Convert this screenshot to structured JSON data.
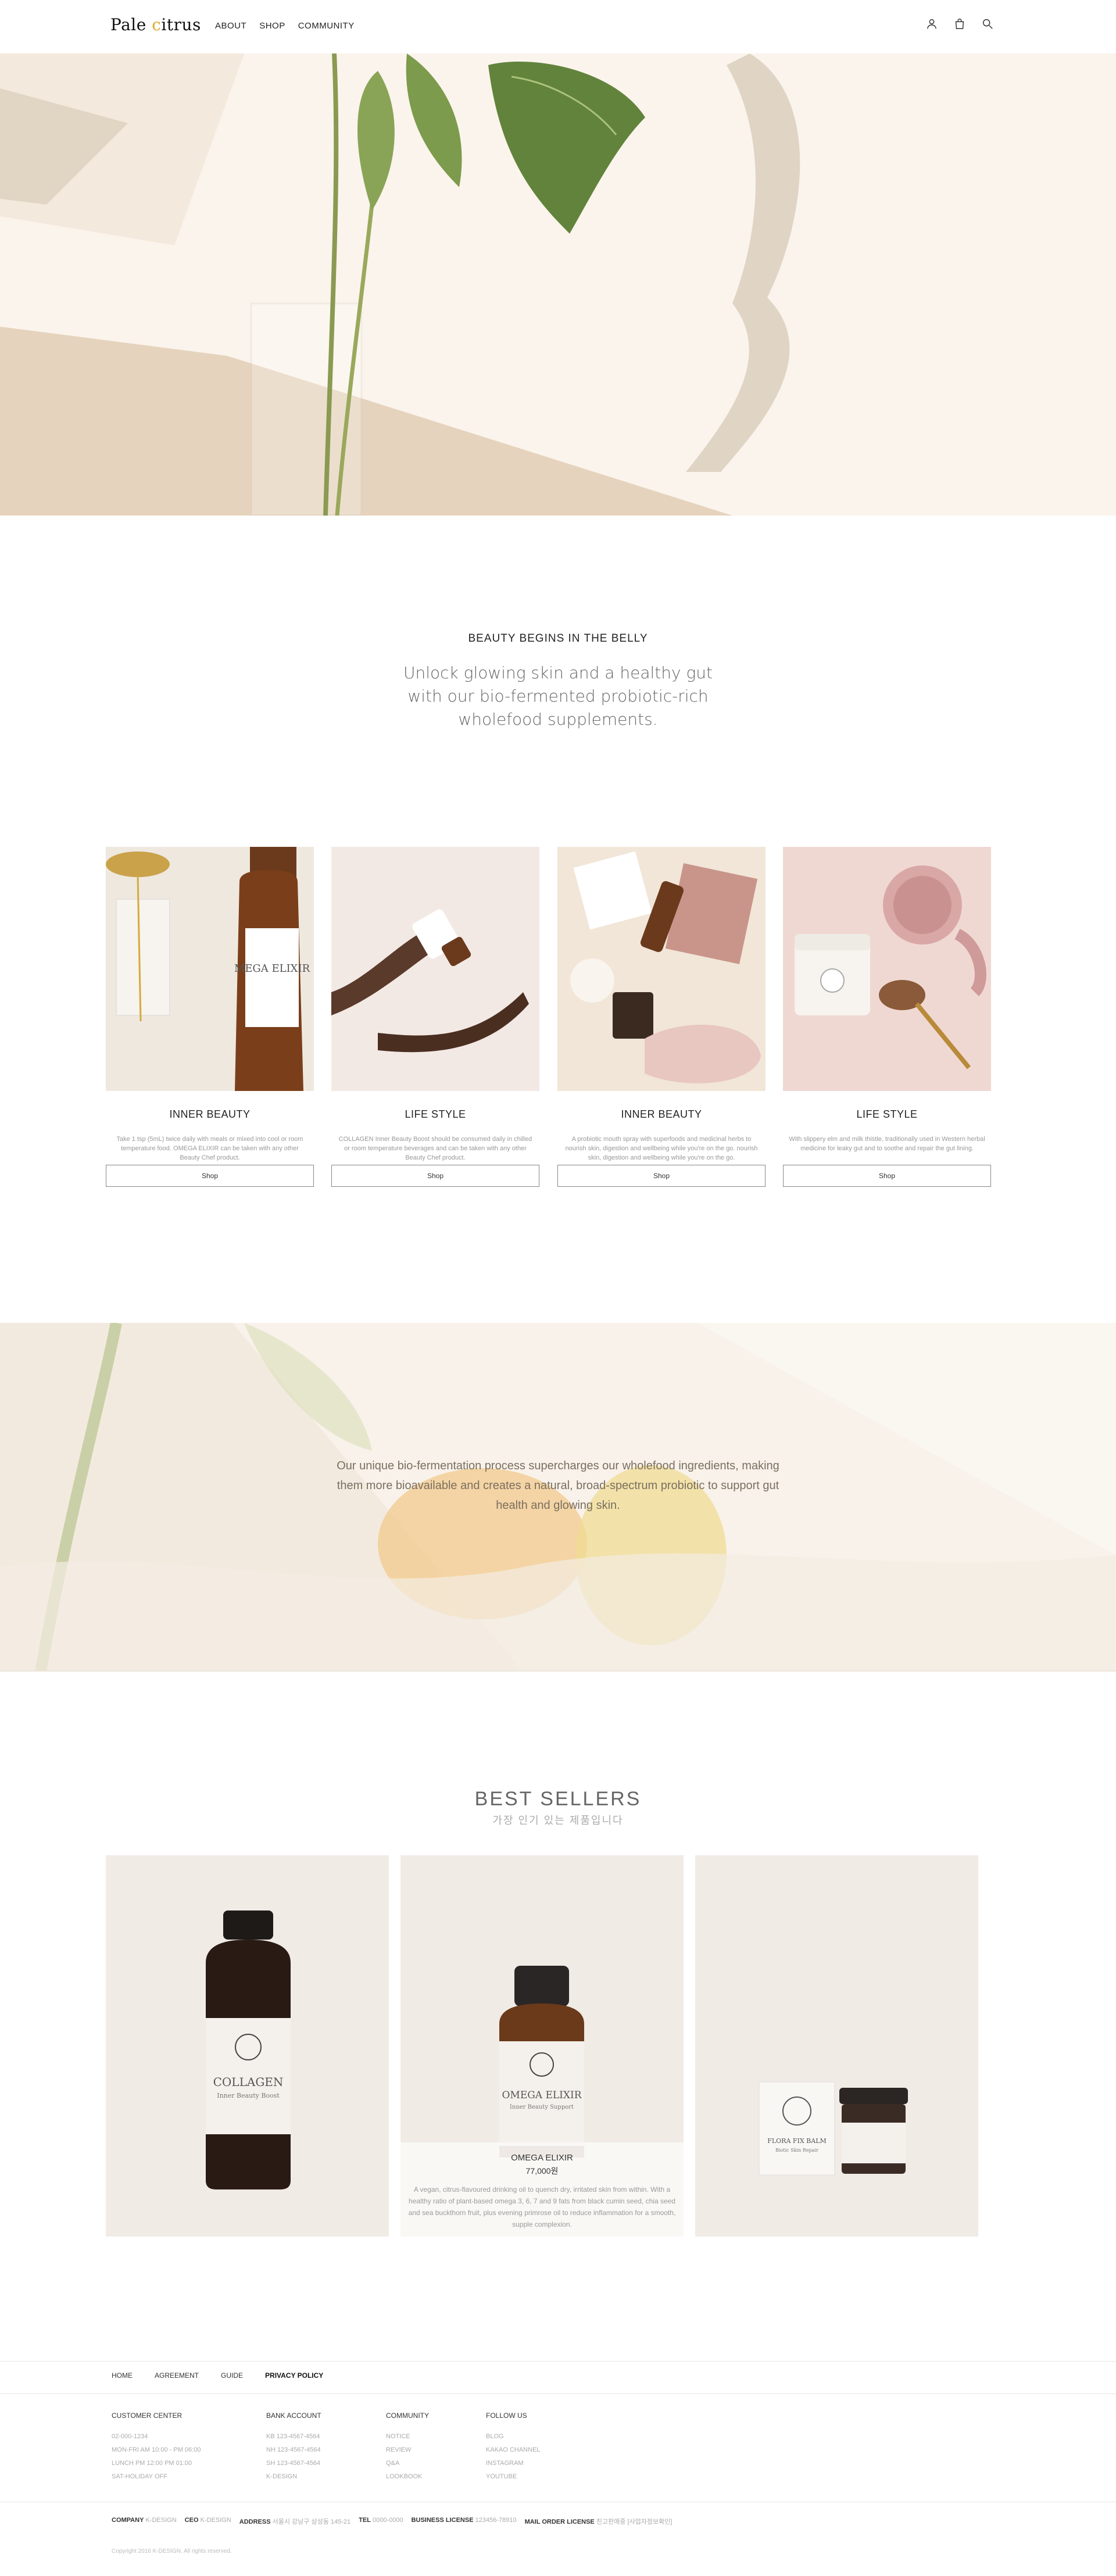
{
  "header": {
    "logo_main": "Pale ",
    "logo_accent": "c",
    "logo_rest": "itrus",
    "nav": [
      "ABOUT",
      "SHOP",
      "COMMUNITY"
    ],
    "icons": [
      "user-icon",
      "bag-icon",
      "search-icon"
    ]
  },
  "hero": {
    "slides": 3,
    "active_slide": 2
  },
  "intro": {
    "title": "BEAUTY BEGINS IN THE BELLY",
    "text": "Unlock glowing skin and a healthy gut with our bio-fermented probiotic-rich wholefood supplements."
  },
  "categories": [
    {
      "title": "INNER BEAUTY",
      "desc": "Take 1 tsp (5mL) twice daily with meals or mixed into cool or room temperature food. OMEGA ELIXIR can be taken with any other Beauty Chef product.",
      "button": "Shop"
    },
    {
      "title": "LIFE STYLE",
      "desc": "COLLAGEN Inner Beauty Boost should be consumed daily in chilled or room temperature beverages and can be taken with any other Beauty Chef product.",
      "button": "Shop"
    },
    {
      "title": "INNER BEAUTY",
      "desc": "A probiotic mouth spray with superfoods and medicinal herbs to nourish skin, digestion and wellbeing while you're on the go. nourish skin, digestion and wellbeing while you're on the go.",
      "button": "Shop"
    },
    {
      "title": "LIFE STYLE",
      "desc": "With slippery elm and milk thistle, traditionally used in Western herbal medicine for leaky gut and to soothe and repair the gut lining.",
      "button": "Shop"
    }
  ],
  "banner": {
    "text": "Our unique bio-fermentation process supercharges our wholefood ingredients, making them more bioavailable and creates a natural, broad-spectrum probiotic to support gut health and glowing skin."
  },
  "best_sellers": {
    "title": "BEST SELLERS",
    "subtitle": "가장 인기 있는 제품입니다",
    "products": [
      {
        "label": "COLLAGEN",
        "sublabel": "Inner Beauty Boost"
      },
      {
        "label": "OMEGA ELIXIR",
        "sublabel": "Inner Beauty Support",
        "name": "OMEGA ELIXIR",
        "price": "77,000원",
        "desc": "A vegan, citrus-flavoured drinking oil to quench dry, irritated skin from within. With a healthy ratio of plant-based omega 3, 6, 7 and 9 fats from black cumin seed, chia seed and sea buckthorn fruit, plus evening primrose oil to reduce inflammation for a smooth, supple complexion."
      },
      {
        "label": "FLORA FIX BALM",
        "sublabel": "Biotic Skin Repair"
      }
    ]
  },
  "footer": {
    "nav": [
      "HOME",
      "AGREEMENT",
      "GUIDE",
      "PRIVACY POLICY"
    ],
    "columns": [
      {
        "title": "CUSTOMER CENTER",
        "lines": [
          "02-000-1234",
          "MON-FRI AM 10:00 - PM 06:00",
          "LUNCH PM 12:00 PM 01:00",
          "SAT-HOLIDAY OFF"
        ]
      },
      {
        "title": "BANK ACCOUNT",
        "lines": [
          "KB 123-4567-4564",
          "NH 123-4567-4564",
          "SH 123-4567-4564",
          "K-DESIGN"
        ]
      },
      {
        "title": "COMMUNITY",
        "lines": [
          "NOTICE",
          "REVIEW",
          "Q&A",
          "LOOKBOOK"
        ]
      },
      {
        "title": "FOLLOW US",
        "lines": [
          "BLOG",
          "KAKAO CHANNEL",
          "INSTAGRAM",
          "YOUTUBE"
        ]
      }
    ],
    "info": [
      {
        "k": "COMPANY",
        "v": "K-DESIGN"
      },
      {
        "k": "CEO",
        "v": "K-DESIGN"
      },
      {
        "k": "ADDRESS",
        "v": "서울시 강남구 삼성동 145-21"
      },
      {
        "k": "TEL",
        "v": "0000-0000"
      },
      {
        "k": "BUSINESS LICENSE",
        "v": "123456-78910"
      },
      {
        "k": "MAIL ORDER LICENSE",
        "v": "친고판매중 [사업자정보확인]"
      }
    ],
    "copyright": "Copyright 2016 K-DESIGN. All rights reserved."
  }
}
